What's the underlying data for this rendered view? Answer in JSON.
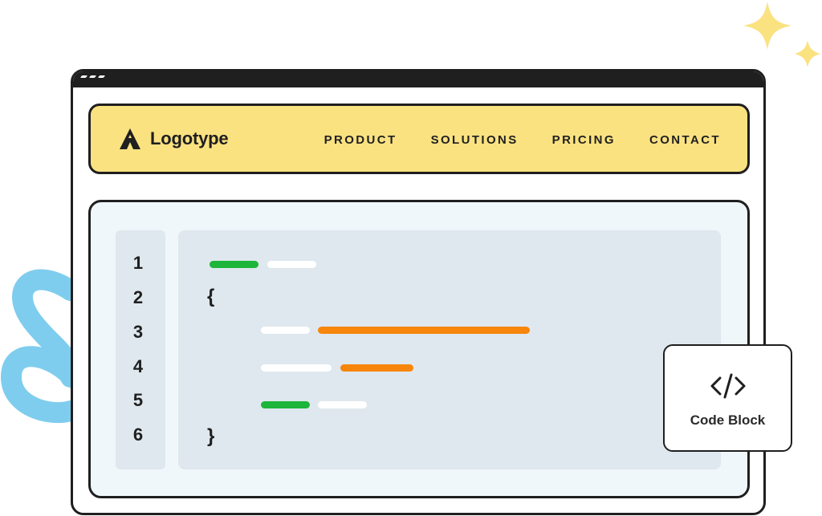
{
  "window": {
    "title_bar_dots": 3
  },
  "header": {
    "logo_text": "Logotype",
    "nav": [
      {
        "label": "PRODUCT"
      },
      {
        "label": "SOLUTIONS"
      },
      {
        "label": "PRICING"
      },
      {
        "label": "CONTACT"
      }
    ]
  },
  "code": {
    "line_numbers": [
      "1",
      "2",
      "3",
      "4",
      "5",
      "6"
    ],
    "open_brace": "{",
    "close_brace": "}"
  },
  "badge": {
    "icon": "code-icon",
    "label": "Code Block"
  },
  "colors": {
    "header_bg": "#fbe281",
    "panel_bg": "#f0f7fb",
    "code_bg": "#dfe8ee",
    "token_green": "#1db53a",
    "token_orange": "#f7860a",
    "token_white": "#ffffff",
    "squiggle_blue": "#7fcdee",
    "sparkle_yellow": "#fbe281",
    "outline": "#1f1f1f"
  }
}
